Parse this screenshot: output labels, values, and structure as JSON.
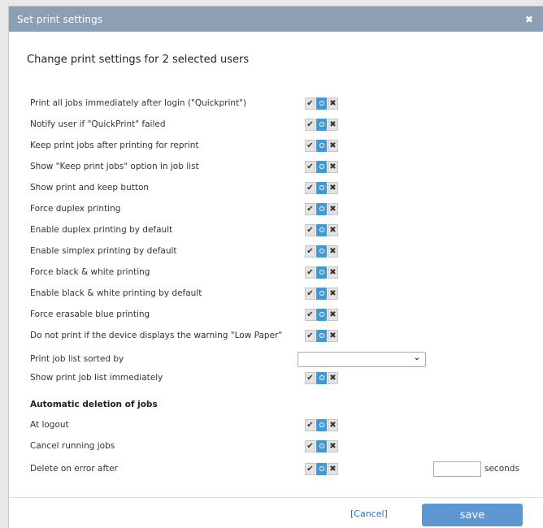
{
  "dialog": {
    "title": "Set print settings",
    "close_icon": "close-icon",
    "heading": "Change print settings for 2 selected users"
  },
  "toggle_icons": [
    "check",
    "circle",
    "x"
  ],
  "settings": [
    {
      "label": "Print all jobs immediately after login (\"Quickprint\")",
      "state": "neutral"
    },
    {
      "label": "Notify user if \"QuickPrint\" failed",
      "state": "neutral"
    },
    {
      "label": "Keep print jobs after printing for reprint",
      "state": "neutral"
    },
    {
      "label": "Show \"Keep print jobs\" option in job list",
      "state": "neutral"
    },
    {
      "label": "Show print and keep button",
      "state": "neutral"
    },
    {
      "label": "Force duplex printing",
      "state": "neutral"
    },
    {
      "label": "Enable duplex printing by default",
      "state": "neutral"
    },
    {
      "label": "Enable simplex printing by default",
      "state": "neutral"
    },
    {
      "label": "Force black & white printing",
      "state": "neutral"
    },
    {
      "label": "Enable black & white printing by default",
      "state": "neutral"
    },
    {
      "label": "Force erasable blue printing",
      "state": "neutral"
    },
    {
      "label": "Do not print if the device displays the warning \"Low Paper\"",
      "state": "neutral"
    }
  ],
  "sort": {
    "label": "Print job list sorted by",
    "value": ""
  },
  "show_list": {
    "label": "Show print job list immediately",
    "state": "neutral"
  },
  "deletion": {
    "title": "Automatic deletion of jobs",
    "at_logout": {
      "label": "At logout",
      "state": "neutral"
    },
    "cancel_running": {
      "label": "Cancel running jobs",
      "state": "neutral"
    },
    "delete_on_error": {
      "label": "Delete on error after",
      "state": "neutral",
      "seconds_value": "",
      "seconds_label": "seconds"
    }
  },
  "footer": {
    "cancel_label": "[Cancel]",
    "save_label": "save"
  },
  "colors": {
    "titlebar": "#8e9fb3",
    "toggle_active": "#3e9bd6",
    "save_button": "#5e97d0"
  }
}
